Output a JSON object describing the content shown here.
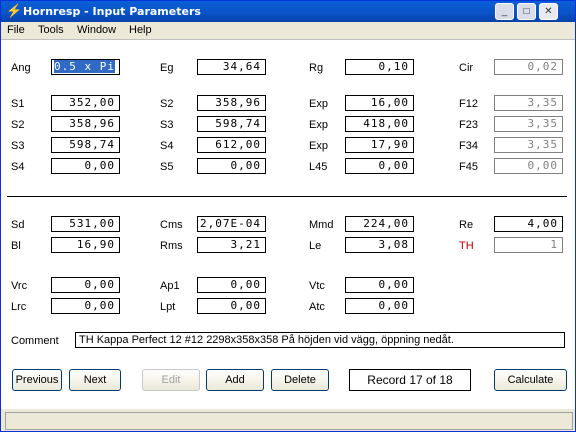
{
  "window": {
    "title": "Hornresp - Input Parameters"
  },
  "menu": [
    "File",
    "Tools",
    "Window",
    "Help"
  ],
  "titlebar_buttons": {
    "minimize": "_",
    "maximize": "□",
    "close": "✕"
  },
  "params": {
    "Ang": "0.5 x Pi",
    "Eg": "34,64",
    "Rg": "0,10",
    "Cir": "0,02",
    "S1": "352,00",
    "S2": "358,96",
    "Exp1": "16,00",
    "F12": "3,35",
    "S2b": "358,96",
    "S3": "598,74",
    "Exp2": "418,00",
    "F23": "3,35",
    "S3b": "598,74",
    "S4": "612,00",
    "Exp3": "17,90",
    "F34": "3,35",
    "S4b": "0,00",
    "S5": "0,00",
    "L45": "0,00",
    "F45": "0,00",
    "Sd": "531,00",
    "Cms": "2,07E-04",
    "Mmd": "224,00",
    "Re": "4,00",
    "Bl": "16,90",
    "Rms": "3,21",
    "Le": "3,08",
    "TH": "1",
    "Vrc": "0,00",
    "Ap1": "0,00",
    "Vtc": "0,00",
    "Lrc": "0,00",
    "Lpt": "0,00",
    "Atc": "0,00"
  },
  "labels": {
    "Ang": "Ang",
    "Eg": "Eg",
    "Rg": "Rg",
    "Cir": "Cir",
    "S1": "S1",
    "S2": "S2",
    "Exp": "Exp",
    "F12": "F12",
    "S3": "S3",
    "F23": "F23",
    "S4": "S4",
    "F34": "F34",
    "S5": "S5",
    "L45": "L45",
    "F45": "F45",
    "Sd": "Sd",
    "Cms": "Cms",
    "Mmd": "Mmd",
    "Re": "Re",
    "Bl": "Bl",
    "Rms": "Rms",
    "Le": "Le",
    "TH": "TH",
    "Vrc": "Vrc",
    "Ap1": "Ap1",
    "Vtc": "Vtc",
    "Lrc": "Lrc",
    "Lpt": "Lpt",
    "Atc": "Atc",
    "Comment": "Comment"
  },
  "comment": "TH Kappa Perfect 12 #12 2298x358x358 På höjden vid vägg, öppning nedåt.",
  "buttons": {
    "previous": "Previous",
    "next": "Next",
    "edit": "Edit",
    "add": "Add",
    "delete": "Delete",
    "calculate": "Calculate"
  },
  "record": "Record 17 of 18",
  "colors": {
    "titlebar": "#0952c7",
    "selection": "#316ac5",
    "th_label": "#c00000"
  }
}
